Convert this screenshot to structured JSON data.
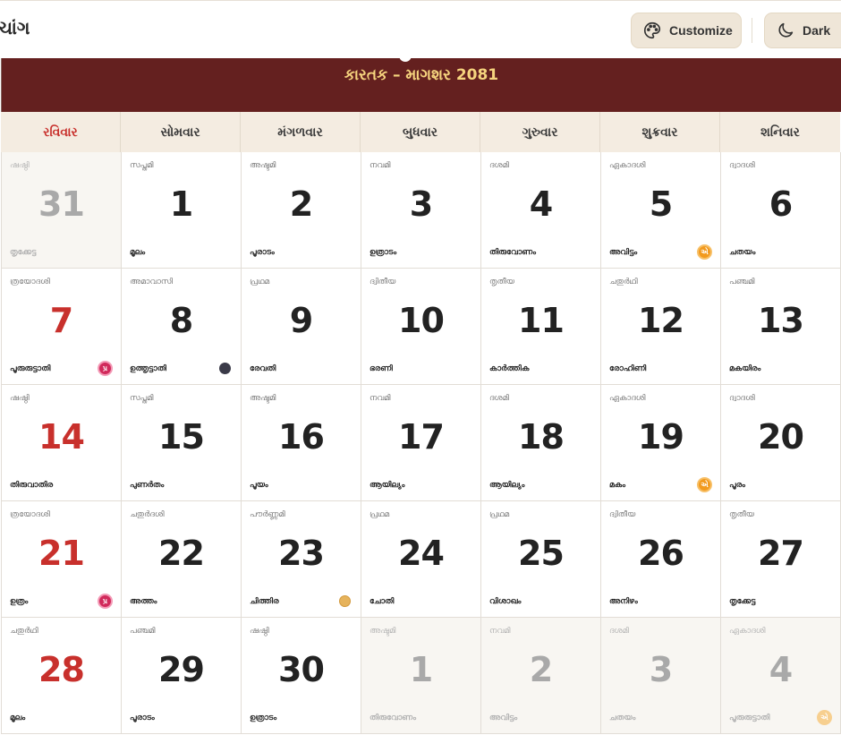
{
  "header": {
    "title_fragment": "ચાંગ",
    "customize_label": "Customize",
    "dark_label": "Dark",
    "icons": [
      "palette-icon",
      "moon-icon"
    ]
  },
  "calendar": {
    "month_title": "કારતક – માગશર 2081",
    "colors": {
      "band": "#64201f",
      "title": "#f6d47e",
      "sunday": "#c8302c"
    },
    "weekdays": [
      "રવિવાર",
      "સોમવાર",
      "મંગળવાર",
      "બુધવાર",
      "ગુરુવાર",
      "શુક્રવાર",
      "શનિવાર"
    ],
    "cells": [
      {
        "tithi": "ഷഷ്ഠി",
        "day": "31",
        "nakshatra": "തൃക്കേട്ട",
        "muted": true,
        "sunday": true,
        "marker": ""
      },
      {
        "tithi": "സപ്തമി",
        "day": "1",
        "nakshatra": "മൂലം",
        "muted": false,
        "sunday": false,
        "marker": ""
      },
      {
        "tithi": "അഷ്ടമി",
        "day": "2",
        "nakshatra": "പൂരാടം",
        "muted": false,
        "sunday": false,
        "marker": ""
      },
      {
        "tithi": "നവമി",
        "day": "3",
        "nakshatra": "ഉത്രാടം",
        "muted": false,
        "sunday": false,
        "marker": ""
      },
      {
        "tithi": "ദശമി",
        "day": "4",
        "nakshatra": "തിരുവോണം",
        "muted": false,
        "sunday": false,
        "marker": ""
      },
      {
        "tithi": "ഏകാദശി",
        "day": "5",
        "nakshatra": "അവിട്ടം",
        "muted": false,
        "sunday": false,
        "marker": "ekadashi",
        "badge": "એ"
      },
      {
        "tithi": "ദ്വാദശി",
        "day": "6",
        "nakshatra": "ചതയം",
        "muted": false,
        "sunday": false,
        "marker": ""
      },
      {
        "tithi": "ത്രയോദശി",
        "day": "7",
        "nakshatra": "പൂരുരുട്ടാതി",
        "muted": false,
        "sunday": true,
        "marker": "pradosh",
        "badge": "પ્ર"
      },
      {
        "tithi": "അമാവാസി",
        "day": "8",
        "nakshatra": "ഉത്തൃട്ടാതി",
        "muted": false,
        "sunday": false,
        "marker": "new-moon"
      },
      {
        "tithi": "പ്രഥമ",
        "day": "9",
        "nakshatra": "രേവതി",
        "muted": false,
        "sunday": false,
        "marker": ""
      },
      {
        "tithi": "ദ്വിതീയ",
        "day": "10",
        "nakshatra": "ഭരണി",
        "muted": false,
        "sunday": false,
        "marker": ""
      },
      {
        "tithi": "തൃതീയ",
        "day": "11",
        "nakshatra": "കാർത്തിക",
        "muted": false,
        "sunday": false,
        "marker": ""
      },
      {
        "tithi": "ചതുർഥി",
        "day": "12",
        "nakshatra": "രോഹിണി",
        "muted": false,
        "sunday": false,
        "marker": ""
      },
      {
        "tithi": "പഞ്ചമി",
        "day": "13",
        "nakshatra": "മകയിരം",
        "muted": false,
        "sunday": false,
        "marker": ""
      },
      {
        "tithi": "ഷഷ്ഠി",
        "day": "14",
        "nakshatra": "തിരുവാതിര",
        "muted": false,
        "sunday": true,
        "marker": ""
      },
      {
        "tithi": "സപ്തമി",
        "day": "15",
        "nakshatra": "പുണർതം",
        "muted": false,
        "sunday": false,
        "marker": ""
      },
      {
        "tithi": "അഷ്ടമി",
        "day": "16",
        "nakshatra": "പൂയം",
        "muted": false,
        "sunday": false,
        "marker": ""
      },
      {
        "tithi": "നവമി",
        "day": "17",
        "nakshatra": "ആയില്യം",
        "muted": false,
        "sunday": false,
        "marker": ""
      },
      {
        "tithi": "ദശമി",
        "day": "18",
        "nakshatra": "ആയില്യം",
        "muted": false,
        "sunday": false,
        "marker": ""
      },
      {
        "tithi": "ഏകാദശി",
        "day": "19",
        "nakshatra": "മകം",
        "muted": false,
        "sunday": false,
        "marker": "ekadashi",
        "badge": "એ"
      },
      {
        "tithi": "ദ്വാദശി",
        "day": "20",
        "nakshatra": "പൂരം",
        "muted": false,
        "sunday": false,
        "marker": ""
      },
      {
        "tithi": "ത്രയോദശി",
        "day": "21",
        "nakshatra": "ഉത്രം",
        "muted": false,
        "sunday": true,
        "marker": "pradosh",
        "badge": "પ્ર"
      },
      {
        "tithi": "ചതുർദശി",
        "day": "22",
        "nakshatra": "അത്തം",
        "muted": false,
        "sunday": false,
        "marker": ""
      },
      {
        "tithi": "പൗർണ്ണമി",
        "day": "23",
        "nakshatra": "ചിത്തിര",
        "muted": false,
        "sunday": false,
        "marker": "full-moon"
      },
      {
        "tithi": "പ്രഥമ",
        "day": "24",
        "nakshatra": "ചോതി",
        "muted": false,
        "sunday": false,
        "marker": ""
      },
      {
        "tithi": "പ്രഥമ",
        "day": "25",
        "nakshatra": "വിശാഖം",
        "muted": false,
        "sunday": false,
        "marker": ""
      },
      {
        "tithi": "ദ്വിതീയ",
        "day": "26",
        "nakshatra": "അനിഴം",
        "muted": false,
        "sunday": false,
        "marker": ""
      },
      {
        "tithi": "തൃതീയ",
        "day": "27",
        "nakshatra": "തൃക്കേട്ട",
        "muted": false,
        "sunday": false,
        "marker": ""
      },
      {
        "tithi": "ചതുർഥി",
        "day": "28",
        "nakshatra": "മൂലം",
        "muted": false,
        "sunday": true,
        "marker": ""
      },
      {
        "tithi": "പഞ്ചമി",
        "day": "29",
        "nakshatra": "പൂരാടം",
        "muted": false,
        "sunday": false,
        "marker": ""
      },
      {
        "tithi": "ഷഷ്ഠി",
        "day": "30",
        "nakshatra": "ഉത്രാടം",
        "muted": false,
        "sunday": false,
        "marker": ""
      },
      {
        "tithi": "അഷ്ടമി",
        "day": "1",
        "nakshatra": "തിരുവോണം",
        "muted": true,
        "sunday": false,
        "marker": ""
      },
      {
        "tithi": "നവമി",
        "day": "2",
        "nakshatra": "അവിട്ടം",
        "muted": true,
        "sunday": false,
        "marker": ""
      },
      {
        "tithi": "ദശമി",
        "day": "3",
        "nakshatra": "ചതയം",
        "muted": true,
        "sunday": false,
        "marker": ""
      },
      {
        "tithi": "ഏകാദശി",
        "day": "4",
        "nakshatra": "പൂരുരുട്ടാതി",
        "muted": true,
        "sunday": false,
        "marker": "ekadashi-muted",
        "badge": "એ"
      }
    ]
  }
}
